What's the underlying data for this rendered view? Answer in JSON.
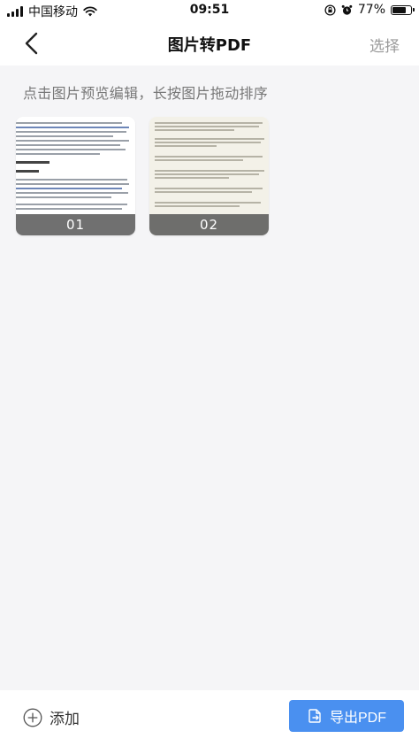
{
  "status_bar": {
    "carrier": "中国移动",
    "time": "09:51",
    "battery_percent": "77%",
    "battery_level": 0.77,
    "icons": [
      "signal-icon",
      "wifi-icon",
      "orientation-lock-icon",
      "alarm-icon",
      "battery-icon"
    ]
  },
  "nav": {
    "back_icon": "chevron-left-icon",
    "title": "图片转PDF",
    "select_label": "选择"
  },
  "main": {
    "hint": "点击图片预览编辑，长按图片拖动排序",
    "thumbnails": [
      {
        "label": "01"
      },
      {
        "label": "02"
      }
    ]
  },
  "bottom": {
    "add_icon": "plus-circle-icon",
    "add_label": "添加",
    "export_icon": "export-file-icon",
    "export_label": "导出PDF",
    "accent_color": "#4a90f0"
  }
}
